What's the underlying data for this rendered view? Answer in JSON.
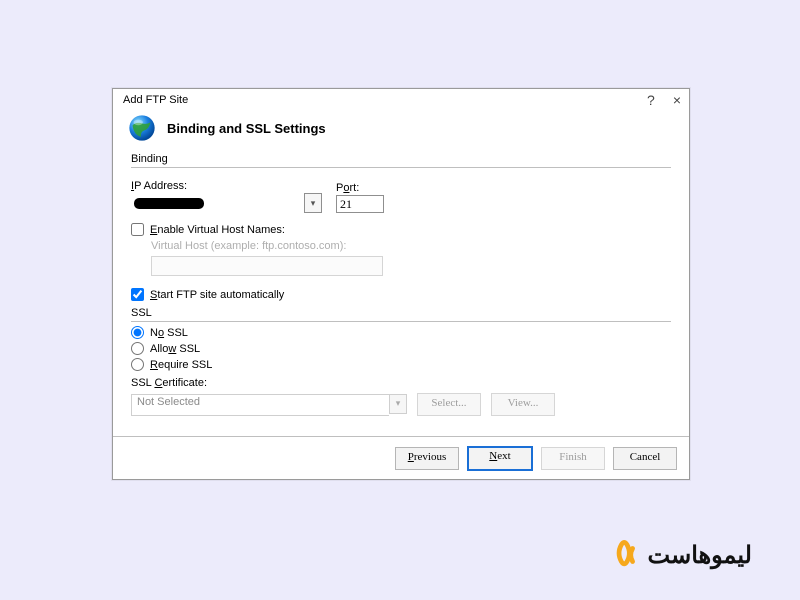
{
  "window": {
    "title": "Add FTP Site",
    "help": "?",
    "close": "×"
  },
  "header": {
    "heading": "Binding and SSL Settings"
  },
  "binding": {
    "group_label": "Binding",
    "ip_label": "IP Address:",
    "ip_value": "",
    "port_label": "Port:",
    "port_value": "21"
  },
  "vhost": {
    "check_label": "Enable Virtual Host Names:",
    "hint": "Virtual Host (example: ftp.contoso.com):"
  },
  "autostart": {
    "label": "Start FTP site automatically"
  },
  "ssl": {
    "group_label": "SSL",
    "no_ssl": "No SSL",
    "allow_ssl": "Allow SSL",
    "require_ssl": "Require SSL",
    "cert_label": "SSL Certificate:",
    "cert_value": "Not Selected",
    "select_btn": "Select...",
    "view_btn": "View..."
  },
  "footer": {
    "previous": "Previous",
    "next": "Next",
    "finish": "Finish",
    "cancel": "Cancel"
  },
  "brand": {
    "text": "لیموهاست"
  }
}
